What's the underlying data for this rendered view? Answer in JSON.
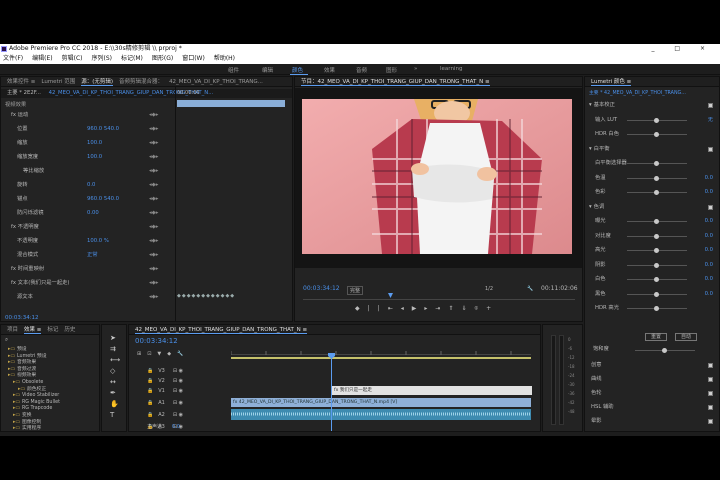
{
  "window": {
    "title": "Adobe Premiere Pro CC 2018 - E:\\\\30s精修剪辑 \\\\ prproj *",
    "controls": "_ □ ×"
  },
  "menu": [
    "文件(F)",
    "编辑(E)",
    "剪辑(C)",
    "序列(S)",
    "标记(M)",
    "图形(G)",
    "窗口(W)",
    "帮助(H)"
  ],
  "workspaces": [
    "组件",
    "编辑",
    "颜色",
    "效果",
    "音频",
    "图形",
    "»",
    "learning"
  ],
  "active_workspace": "颜色",
  "effect_controls": {
    "tabs": [
      "效果控件 ≡",
      "Lumetri 范围",
      "源：(无剪辑)",
      "音频剪辑混合器：",
      "42_MEO_VA_DI_KP_THOI_TRANG..."
    ],
    "source_label": "主要 * 2E2F...",
    "clip_label": "42_MEO_VA_DI_KP_THOI_TRANG_GIUP_DAN_TRONG_THAT_N...",
    "seq_time": "00:00:00",
    "video_section": "视频效果",
    "rows": [
      {
        "label": "fx 运动",
        "value": "",
        "indent": 1
      },
      {
        "label": "位置",
        "value": "960.0   540.0",
        "indent": 2
      },
      {
        "label": "缩放",
        "value": "100.0",
        "indent": 2
      },
      {
        "label": "缩放宽度",
        "value": "100.0",
        "indent": 2
      },
      {
        "label": "等比缩放",
        "value": "",
        "indent": 3
      },
      {
        "label": "旋转",
        "value": "0.0",
        "indent": 2
      },
      {
        "label": "锚点",
        "value": "960.0   540.0",
        "indent": 2
      },
      {
        "label": "防闪烁滤镜",
        "value": "0.00",
        "indent": 2
      },
      {
        "label": "fx 不透明度",
        "value": "",
        "indent": 1
      },
      {
        "label": "不透明度",
        "value": "100.0 %",
        "indent": 2
      },
      {
        "label": "混合模式",
        "value": "正常",
        "indent": 2
      },
      {
        "label": "fx 时间重映射",
        "value": "",
        "indent": 1
      },
      {
        "label": "fx 文本(我们只是一起走)",
        "value": "",
        "indent": 1
      },
      {
        "label": "源文本",
        "value": "",
        "indent": 2
      }
    ],
    "footer_time": "00:03:34:12"
  },
  "program_monitor": {
    "tab": "节目：42_MEO_VA_DI_KP_THOI_TRANG_GIUP_DAN_TRONG_THAT_N ≡",
    "current_time": "00:03:34:12",
    "zoom": "完整",
    "duration": "00:11:02:06",
    "fit": "1/2"
  },
  "project_panel": {
    "tabs": [
      "项目",
      "效果 ≡",
      "标记",
      "历史"
    ],
    "items": [
      {
        "name": "预设",
        "indent": 1
      },
      {
        "name": "Lumetri 预设",
        "indent": 1
      },
      {
        "name": "音频效果",
        "indent": 1
      },
      {
        "name": "音频过渡",
        "indent": 1
      },
      {
        "name": "视频效果",
        "indent": 1
      },
      {
        "name": "Obsolete",
        "indent": 2
      },
      {
        "name": "颜色校正",
        "indent": 3
      },
      {
        "name": "Video Stabilizer",
        "indent": 2
      },
      {
        "name": "RG Magic Bullet",
        "indent": 2
      },
      {
        "name": "RG Trapcode",
        "indent": 2
      },
      {
        "name": "变换",
        "indent": 2
      },
      {
        "name": "图像控制",
        "indent": 2
      },
      {
        "name": "实用程序",
        "indent": 2
      }
    ]
  },
  "timeline": {
    "tab": "42_MEO_VA_DI_KP_THOI_TRANG_GIUP_DAN_TRONG_THAT_N ≡",
    "time": "00:03:34:12",
    "tracks": [
      "V3",
      "V2",
      "V1",
      "A1",
      "A2",
      "A3",
      "主声道"
    ],
    "master_value": "0.0",
    "text_clip": "fx 我们只是一起走",
    "video_clip": "fx 42_MEO_VA_DI_KP_THOI_TRANG_GIUP_DAN_TRONG_THAT_N.mp4 [V]"
  },
  "lumetri": {
    "title": "Lumetri 颜色 ≡",
    "clip": "主要 * 42_MEO_VA_DI_KP_THOI_TRANG...",
    "sections": [
      {
        "name": "基本校正",
        "open": true
      },
      {
        "name": "输入 LUT",
        "value": "无"
      },
      {
        "name": "HDR 白色",
        "value": ""
      },
      {
        "name": "白平衡",
        "open": true
      },
      {
        "name": "白平衡选择器",
        "value": ""
      },
      {
        "name": "色温",
        "value": "0.0"
      },
      {
        "name": "色彩",
        "value": "0.0"
      },
      {
        "name": "色调",
        "open": true
      },
      {
        "name": "曝光",
        "value": "0.0"
      },
      {
        "name": "对比度",
        "value": "0.0"
      },
      {
        "name": "高光",
        "value": "0.0"
      },
      {
        "name": "阴影",
        "value": "0.0"
      },
      {
        "name": "白色",
        "value": "0.0"
      },
      {
        "name": "黑色",
        "value": "0.0"
      },
      {
        "name": "HDR 高光",
        "value": ""
      }
    ],
    "reset_label": "重置",
    "auto_label": "自动",
    "saturation_label": "饱和度",
    "saturation_value": "100.0",
    "bottom_sections": [
      "创意",
      "曲线",
      "色轮",
      "HSL 辅助",
      "晕影"
    ]
  }
}
